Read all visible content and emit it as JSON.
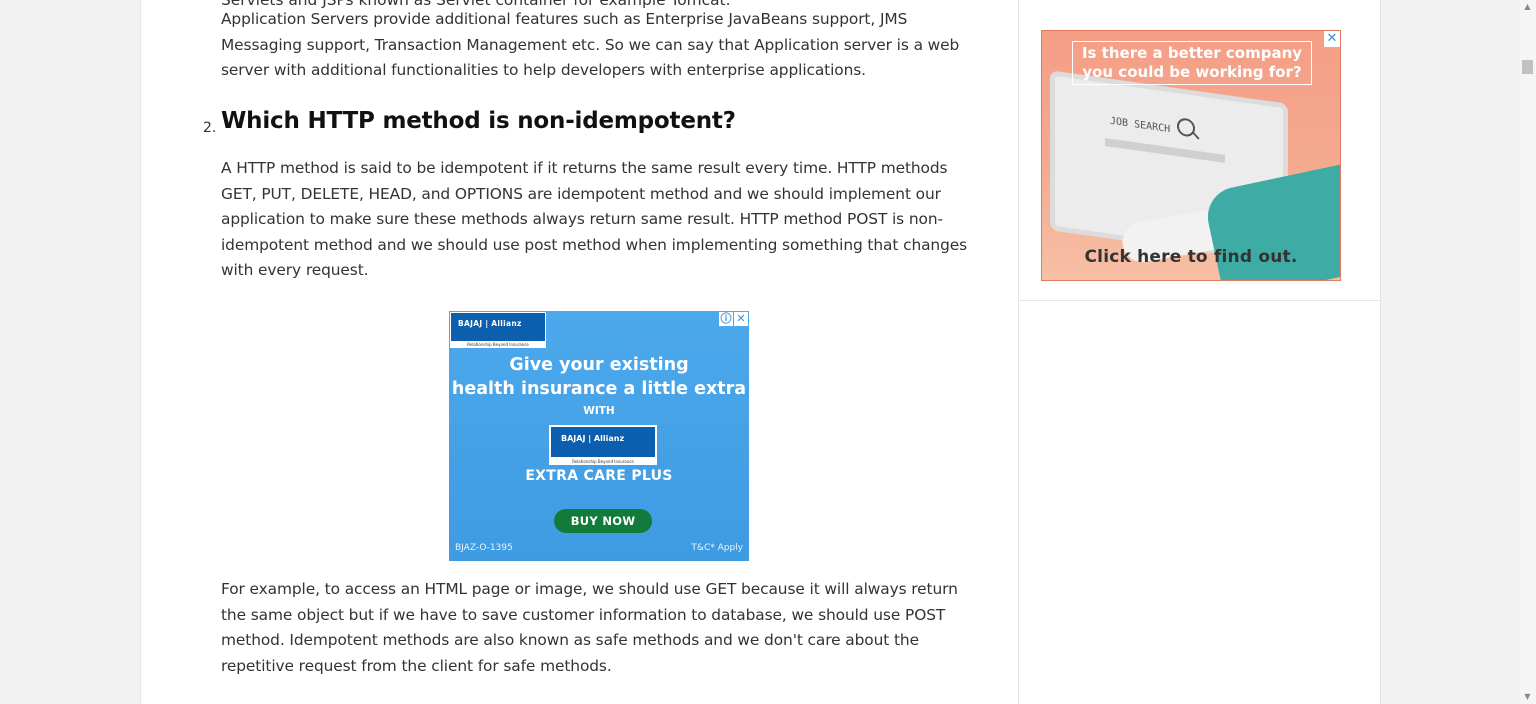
{
  "article": {
    "cut_line": "Servlets and JSPs known as Servlet container for example Tomcat.",
    "para1": "Application Servers provide additional features such as Enterprise JavaBeans support, JMS Messaging support, Transaction Management etc. So we can say that Application server is a web server with additional functionalities to help developers with enterprise applications.",
    "heading_number": "2.",
    "heading": "Which HTTP method is non-idempotent?",
    "para2": "A HTTP method is said to be idempotent if it returns the same result every time. HTTP methods GET, PUT, DELETE, HEAD, and OPTIONS are idempotent method and we should implement our application to make sure these methods always return same result. HTTP method POST is non-idempotent method and we should use post method when implementing something that changes with every request.",
    "para3": "For example, to access an HTML page or image, we should use GET because it will always return the same object but if we have to save customer information to database, we should use POST method. Idempotent methods are also known as safe methods and we don't care about the repetitive request from the client for safe methods."
  },
  "ad_bajaj": {
    "logo_text": "BAJAJ | Allianz",
    "logo_tagline": "Relationship Beyond Insurance",
    "info_icon": "ⓘ",
    "close_icon": "✕",
    "headline_line1": "Give your existing",
    "headline_line2": "health insurance a little extra",
    "with": "WITH",
    "product": "EXTRA CARE PLUS",
    "button": "BUY NOW",
    "code": "BJAZ-O-1395",
    "tc": "T&C* Apply"
  },
  "ad_job": {
    "title_line1": "Is there a better company",
    "title_line2": "you could be working for?",
    "screen_text": "JOB SEARCH",
    "cta": "Click here to find out.",
    "close_icon": "✕"
  },
  "scrollbar": {
    "up": "▲",
    "down": "▼"
  },
  "colors": {
    "bajaj_blue": "#4da9ec",
    "buy_green": "#127a3a",
    "job_coral": "#f59e86"
  }
}
